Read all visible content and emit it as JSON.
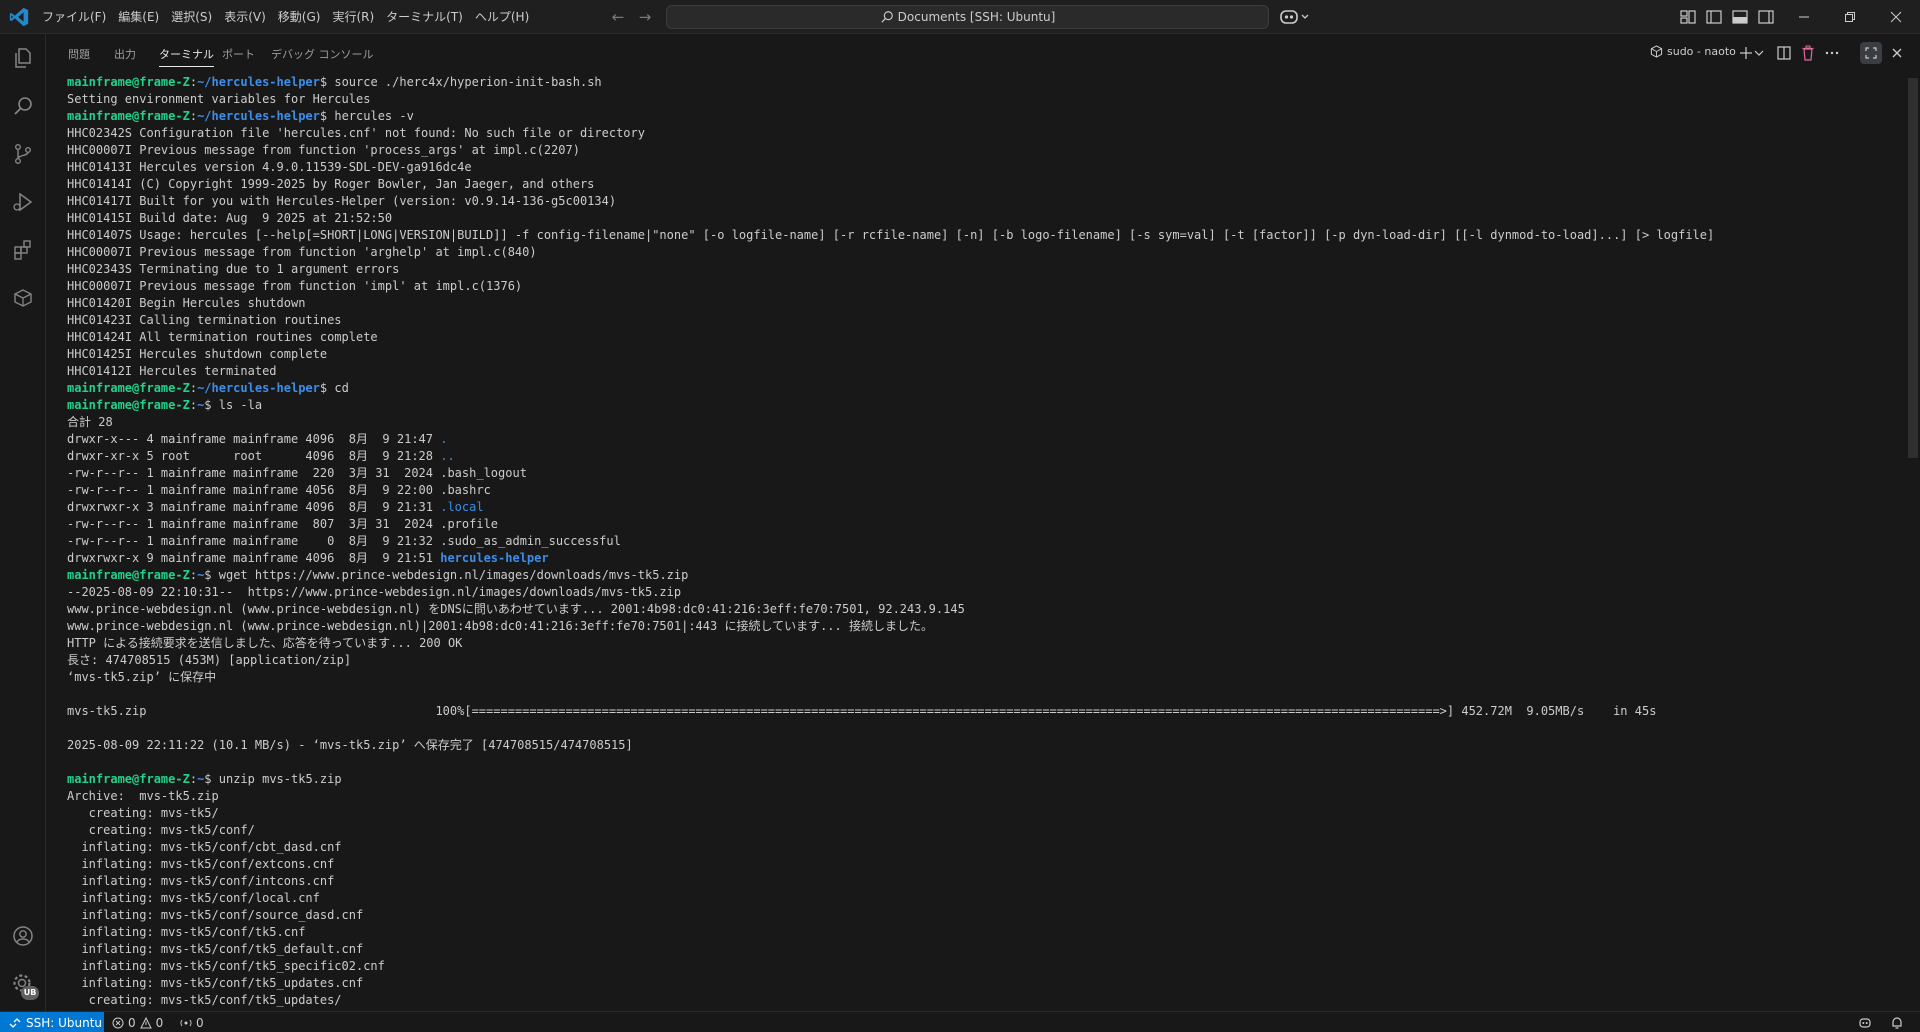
{
  "titlebar": {
    "menu": [
      "ファイル(F)",
      "編集(E)",
      "選択(S)",
      "表示(V)",
      "移動(G)",
      "実行(R)",
      "ターミナル(T)",
      "ヘルプ(H)"
    ],
    "search_text": "Documents [SSH: Ubuntu]"
  },
  "panel": {
    "tabs": [
      "問題",
      "出力",
      "ターミナル",
      "ポート",
      "デバッグ コンソール"
    ],
    "active_tab": "ターミナル",
    "terminal_name": "sudo - naoto"
  },
  "terminal": {
    "lines": [
      {
        "user": "mainframe@frame-Z",
        "path": "~/hercules-helper",
        "cmd": " source ./herc4x/hyperion-init-bash.sh"
      },
      {
        "text": "Setting environment variables for Hercules"
      },
      {
        "user": "mainframe@frame-Z",
        "path": "~/hercules-helper",
        "cmd": " hercules -v"
      },
      {
        "text": "HHC02342S Configuration file 'hercules.cnf' not found: No such file or directory"
      },
      {
        "text": "HHC00007I Previous message from function 'process_args' at impl.c(2207)"
      },
      {
        "text": "HHC01413I Hercules version 4.9.0.11539-SDL-DEV-ga916dc4e"
      },
      {
        "text": "HHC01414I (C) Copyright 1999-2025 by Roger Bowler, Jan Jaeger, and others"
      },
      {
        "text": "HHC01417I Built for you with Hercules-Helper (version: v0.9.14-136-g5c00134)"
      },
      {
        "text": "HHC01415I Build date: Aug  9 2025 at 21:52:50"
      },
      {
        "text": "HHC01407S Usage: hercules [--help[=SHORT|LONG|VERSION|BUILD]] -f config-filename|\"none\" [-o logfile-name] [-r rcfile-name] [-n] [-b logo-filename] [-s sym=val] [-t [factor]] [-p dyn-load-dir] [[-l dynmod-to-load]...] [> logfile]"
      },
      {
        "text": "HHC00007I Previous message from function 'arghelp' at impl.c(840)"
      },
      {
        "text": "HHC02343S Terminating due to 1 argument errors"
      },
      {
        "text": "HHC00007I Previous message from function 'impl' at impl.c(1376)"
      },
      {
        "text": "HHC01420I Begin Hercules shutdown"
      },
      {
        "text": "HHC01423I Calling termination routines"
      },
      {
        "text": "HHC01424I All termination routines complete"
      },
      {
        "text": "HHC01425I Hercules shutdown complete"
      },
      {
        "text": "HHC01412I Hercules terminated"
      },
      {
        "user": "mainframe@frame-Z",
        "path": "~/hercules-helper",
        "cmd": " cd"
      },
      {
        "user": "mainframe@frame-Z",
        "path": "~",
        "cmd": " ls -la"
      },
      {
        "text": "合計 28"
      },
      {
        "text": "drwxr-x--- 4 mainframe mainframe 4096  8月  9 21:47 ",
        "name": ".",
        "style": "dir"
      },
      {
        "text": "drwxr-xr-x 5 root      root      4096  8月  9 21:28 ",
        "name": "..",
        "style": "dir"
      },
      {
        "text": "-rw-r--r-- 1 mainframe mainframe  220  3月 31  2024 .bash_logout"
      },
      {
        "text": "-rw-r--r-- 1 mainframe mainframe 4056  8月  9 22:00 .bashrc"
      },
      {
        "text": "drwxrwxr-x 3 mainframe mainframe 4096  8月  9 21:31 ",
        "name": ".local",
        "style": "dir"
      },
      {
        "text": "-rw-r--r-- 1 mainframe mainframe  807  3月 31  2024 .profile"
      },
      {
        "text": "-rw-r--r-- 1 mainframe mainframe    0  8月  9 21:32 .sudo_as_admin_successful"
      },
      {
        "text": "drwxrwxr-x 9 mainframe mainframe 4096  8月  9 21:51 ",
        "name": "hercules-helper",
        "style": "dirb"
      },
      {
        "user": "mainframe@frame-Z",
        "path": "~",
        "cmd": " wget https://www.prince-webdesign.nl/images/downloads/mvs-tk5.zip"
      },
      {
        "text": "--2025-08-09 22:10:31--  https://www.prince-webdesign.nl/images/downloads/mvs-tk5.zip"
      },
      {
        "text": "www.prince-webdesign.nl (www.prince-webdesign.nl) をDNSに問いあわせています... 2001:4b98:dc0:41:216:3eff:fe70:7501, 92.243.9.145"
      },
      {
        "text": "www.prince-webdesign.nl (www.prince-webdesign.nl)|2001:4b98:dc0:41:216:3eff:fe70:7501|:443 に接続しています... 接続しました。"
      },
      {
        "text": "HTTP による接続要求を送信しました、応答を待っています... 200 OK"
      },
      {
        "text": "長さ: 474708515 (453M) [application/zip]"
      },
      {
        "text": "‘mvs-tk5.zip’ に保存中"
      },
      {
        "text": ""
      },
      {
        "text": "mvs-tk5.zip                                        100%[======================================================================================================================================>] 452.72M  9.05MB/s    in 45s"
      },
      {
        "text": ""
      },
      {
        "text": "2025-08-09 22:11:22 (10.1 MB/s) - ‘mvs-tk5.zip’ へ保存完了 [474708515/474708515]"
      },
      {
        "text": ""
      },
      {
        "user": "mainframe@frame-Z",
        "path": "~",
        "cmd": " unzip mvs-tk5.zip"
      },
      {
        "text": "Archive:  mvs-tk5.zip"
      },
      {
        "text": "   creating: mvs-tk5/"
      },
      {
        "text": "   creating: mvs-tk5/conf/"
      },
      {
        "text": "  inflating: mvs-tk5/conf/cbt_dasd.cnf"
      },
      {
        "text": "  inflating: mvs-tk5/conf/extcons.cnf"
      },
      {
        "text": "  inflating: mvs-tk5/conf/intcons.cnf"
      },
      {
        "text": "  inflating: mvs-tk5/conf/local.cnf"
      },
      {
        "text": "  inflating: mvs-tk5/conf/source_dasd.cnf"
      },
      {
        "text": "  inflating: mvs-tk5/conf/tk5.cnf"
      },
      {
        "text": "  inflating: mvs-tk5/conf/tk5_default.cnf"
      },
      {
        "text": "  inflating: mvs-tk5/conf/tk5_specific02.cnf"
      },
      {
        "text": "  inflating: mvs-tk5/conf/tk5_updates.cnf"
      },
      {
        "text": "   creating: mvs-tk5/conf/tk5_updates/"
      }
    ]
  },
  "statusbar": {
    "remote": "SSH: Ubuntu",
    "errors": "0",
    "warnings": "0",
    "ports": "0"
  },
  "accounts_badge": "UB",
  "colors": {
    "accent": "#0078d4",
    "prompt_user": "#23d18b",
    "prompt_path": "#3b8eea"
  }
}
